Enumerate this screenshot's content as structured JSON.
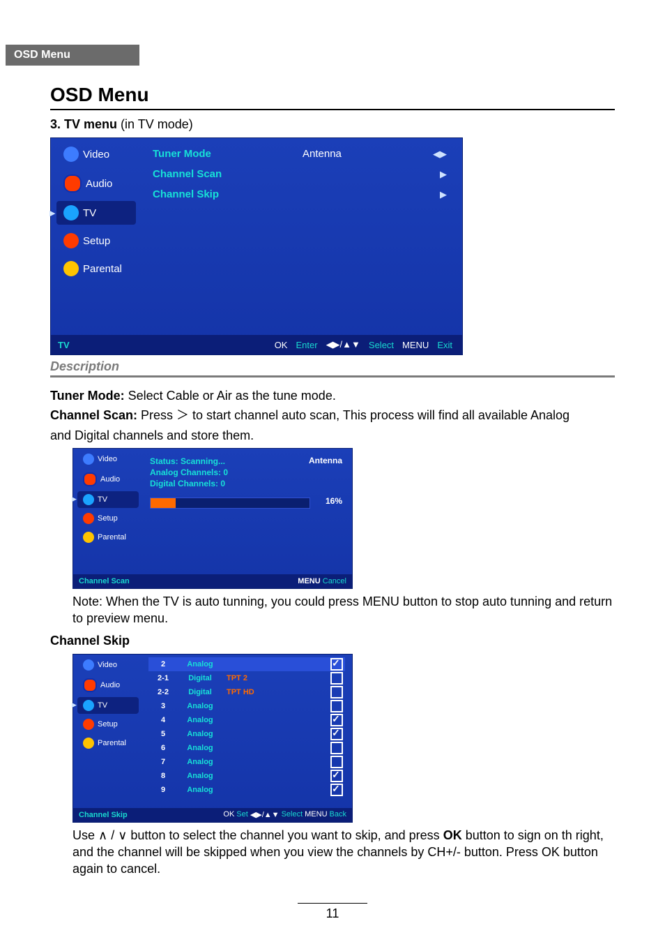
{
  "tab": "OSD Menu",
  "title": "OSD Menu",
  "section": {
    "num": "3. TV menu",
    "suffix": " (in TV mode)"
  },
  "osd1": {
    "sidebar": [
      "Video",
      "Audio",
      "TV",
      "Setup",
      "Parental"
    ],
    "activeIndex": 2,
    "rows": [
      {
        "k": "Tuner Mode",
        "v": "Antenna",
        "arr": "◀▶"
      },
      {
        "k": "Channel Scan",
        "v": "",
        "arr": "▶"
      },
      {
        "k": "Channel Skip",
        "v": "",
        "arr": "▶"
      }
    ],
    "footLeft": "TV",
    "foot": {
      "ok": "OK",
      "enter": "Enter",
      "sym": "◀▶/▲▼",
      "sel": "Select",
      "menu": "MENU",
      "exit": "Exit"
    }
  },
  "descHeading": "Description",
  "desc": {
    "tunerLabel": "Tuner Mode:",
    "tunerText": " Select Cable or Air as the tune mode.",
    "scanLabel": "Channel Scan:",
    "scanText1": " Press ",
    "scanGlyph": "＞",
    "scanText2": " to start channel auto scan, This process will find all available Analog",
    "scanText3": "and Digital channels and store them."
  },
  "osd2": {
    "sidebar": [
      "Video",
      "Audio",
      "TV",
      "Setup",
      "Parental"
    ],
    "activeIndex": 2,
    "status": [
      "Status: Scanning...",
      "Analog Channels: 0",
      "Digital Channels: 0"
    ],
    "antenna": "Antenna",
    "percent": "16%",
    "footLeft": "Channel Scan",
    "foot": {
      "menu": "MENU",
      "cancel": "Cancel"
    }
  },
  "note": "Note: When the TV is auto tunning, you could press MENU button to stop auto tunning and return to preview menu.",
  "skipHeading": "Channel Skip",
  "osd3": {
    "sidebar": [
      "Video",
      "Audio",
      "TV",
      "Setup",
      "Parental"
    ],
    "activeIndex": 2,
    "rows": [
      {
        "ch": "2",
        "type": "Analog",
        "name": "",
        "checked": true,
        "hdr": true
      },
      {
        "ch": "2-1",
        "type": "Digital",
        "name": "TPT 2",
        "checked": false
      },
      {
        "ch": "2-2",
        "type": "Digital",
        "name": "TPT HD",
        "checked": false
      },
      {
        "ch": "3",
        "type": "Analog",
        "name": "",
        "checked": false
      },
      {
        "ch": "4",
        "type": "Analog",
        "name": "",
        "checked": true
      },
      {
        "ch": "5",
        "type": "Analog",
        "name": "",
        "checked": true
      },
      {
        "ch": "6",
        "type": "Analog",
        "name": "",
        "checked": false
      },
      {
        "ch": "7",
        "type": "Analog",
        "name": "",
        "checked": false
      },
      {
        "ch": "8",
        "type": "Analog",
        "name": "",
        "checked": true
      },
      {
        "ch": "9",
        "type": "Analog",
        "name": "",
        "checked": true
      }
    ],
    "footLeft": "Channel Skip",
    "foot": {
      "ok": "OK",
      "set": "Set",
      "sym": "◀▶/▲▼",
      "sel": "Select",
      "menu": "MENU",
      "back": "Back"
    }
  },
  "skipText": {
    "a": "Use ",
    "up": "∧",
    "sep": " / ",
    "down": "∨",
    "b": " button to select the channel you want to skip, and press ",
    "ok": "OK",
    "c": " button to sign on th right, and the channel will be skipped when you view the channels by CH+/- button. Press OK button again to cancel."
  },
  "pageNumber": "11"
}
